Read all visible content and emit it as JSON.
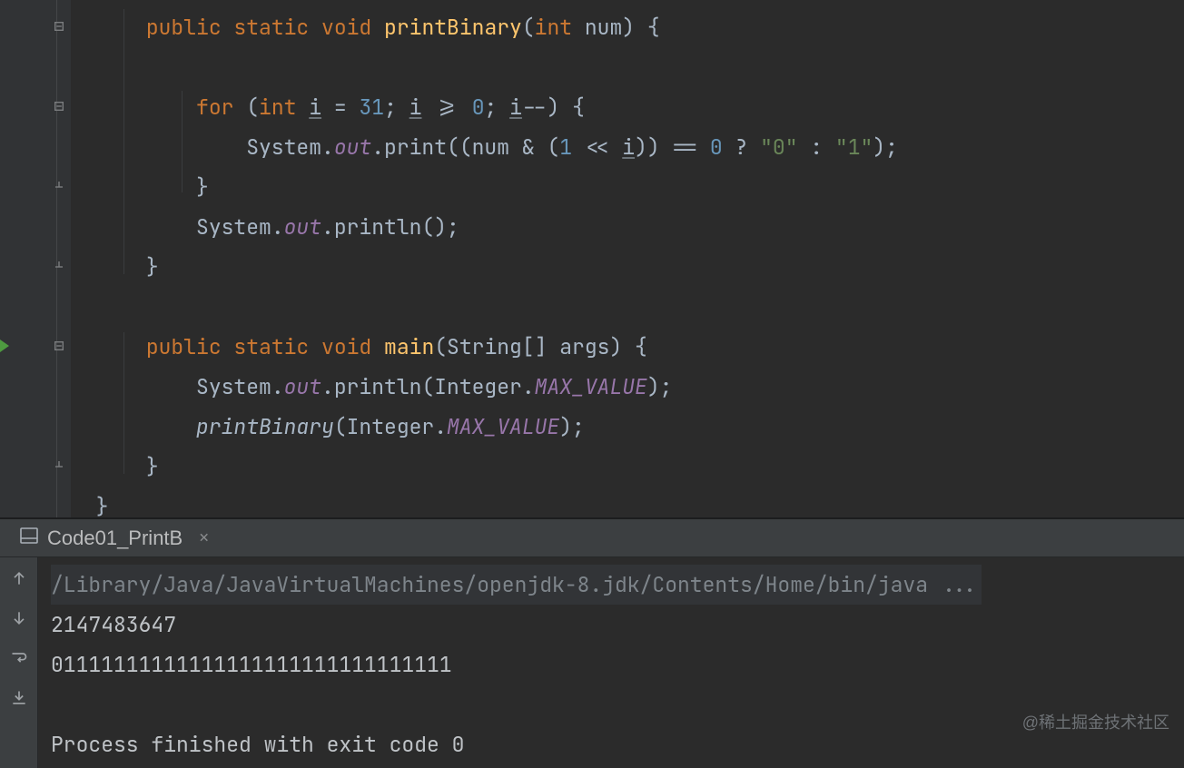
{
  "editor": {
    "code_lines": [
      {
        "indent": 1,
        "tokens": [
          {
            "t": "public ",
            "c": "kw"
          },
          {
            "t": "static ",
            "c": "kw"
          },
          {
            "t": "void ",
            "c": "kw"
          },
          {
            "t": "printBinary",
            "c": "mname"
          },
          {
            "t": "(",
            "c": "punct"
          },
          {
            "t": "int ",
            "c": "type"
          },
          {
            "t": "num",
            "c": "punct"
          },
          {
            "t": ") {",
            "c": "punct"
          }
        ]
      },
      {
        "indent": 0,
        "tokens": []
      },
      {
        "indent": 2,
        "tokens": [
          {
            "t": "for ",
            "c": "kw"
          },
          {
            "t": "(",
            "c": "punct"
          },
          {
            "t": "int ",
            "c": "type"
          },
          {
            "t": "i",
            "c": "punct under"
          },
          {
            "t": " = ",
            "c": "punct"
          },
          {
            "t": "31",
            "c": "num"
          },
          {
            "t": "; ",
            "c": "punct"
          },
          {
            "t": "i",
            "c": "punct under"
          },
          {
            "t": " >= ",
            "c": "punct"
          },
          {
            "t": "0",
            "c": "num"
          },
          {
            "t": "; ",
            "c": "punct"
          },
          {
            "t": "i",
            "c": "punct under"
          },
          {
            "t": "--) {",
            "c": "punct"
          }
        ]
      },
      {
        "indent": 3,
        "tokens": [
          {
            "t": "System.",
            "c": "punct"
          },
          {
            "t": "out",
            "c": "field"
          },
          {
            "t": ".print((num & (",
            "c": "punct"
          },
          {
            "t": "1 ",
            "c": "num"
          },
          {
            "t": "<< ",
            "c": "punct"
          },
          {
            "t": "i",
            "c": "punct under"
          },
          {
            "t": ")) == ",
            "c": "punct"
          },
          {
            "t": "0 ",
            "c": "num"
          },
          {
            "t": "? ",
            "c": "punct"
          },
          {
            "t": "\"0\"",
            "c": "str"
          },
          {
            "t": " : ",
            "c": "punct"
          },
          {
            "t": "\"1\"",
            "c": "str"
          },
          {
            "t": ");",
            "c": "punct"
          }
        ]
      },
      {
        "indent": 2,
        "tokens": [
          {
            "t": "}",
            "c": "punct"
          }
        ]
      },
      {
        "indent": 2,
        "tokens": [
          {
            "t": "System.",
            "c": "punct"
          },
          {
            "t": "out",
            "c": "field"
          },
          {
            "t": ".println();",
            "c": "punct"
          }
        ]
      },
      {
        "indent": 1,
        "tokens": [
          {
            "t": "}",
            "c": "punct"
          }
        ]
      },
      {
        "indent": 0,
        "tokens": []
      },
      {
        "indent": 1,
        "tokens": [
          {
            "t": "public ",
            "c": "kw"
          },
          {
            "t": "static ",
            "c": "kw"
          },
          {
            "t": "void ",
            "c": "kw"
          },
          {
            "t": "main",
            "c": "mname"
          },
          {
            "t": "(String[] args) {",
            "c": "punct"
          }
        ]
      },
      {
        "indent": 2,
        "tokens": [
          {
            "t": "System.",
            "c": "punct"
          },
          {
            "t": "out",
            "c": "field"
          },
          {
            "t": ".println(Integer.",
            "c": "punct"
          },
          {
            "t": "MAX_VALUE",
            "c": "field"
          },
          {
            "t": ");",
            "c": "punct"
          }
        ]
      },
      {
        "indent": 2,
        "tokens": [
          {
            "t": "printBinary",
            "c": "call-italic"
          },
          {
            "t": "(Integer.",
            "c": "punct"
          },
          {
            "t": "MAX_VALUE",
            "c": "field"
          },
          {
            "t": ");",
            "c": "punct"
          }
        ]
      },
      {
        "indent": 1,
        "tokens": [
          {
            "t": "}",
            "c": "punct"
          }
        ]
      },
      {
        "indent": 0,
        "tokens": [
          {
            "t": "}",
            "c": "punct"
          }
        ]
      }
    ],
    "fold_marks": [
      {
        "line": 0,
        "type": "open"
      },
      {
        "line": 2,
        "type": "open"
      },
      {
        "line": 4,
        "type": "close"
      },
      {
        "line": 6,
        "type": "close"
      },
      {
        "line": 8,
        "type": "open"
      },
      {
        "line": 11,
        "type": "close"
      }
    ],
    "run_indicator_line": 8
  },
  "run": {
    "tab_label": "Code01_PrintB",
    "cmd": "/Library/Java/JavaVirtualMachines/openjdk-8.jdk/Contents/Home/bin/java ...",
    "out_lines": [
      "2147483647",
      "01111111111111111111111111111111",
      "",
      "Process finished with exit code 0"
    ]
  },
  "watermark": "@稀土掘金技术社区"
}
